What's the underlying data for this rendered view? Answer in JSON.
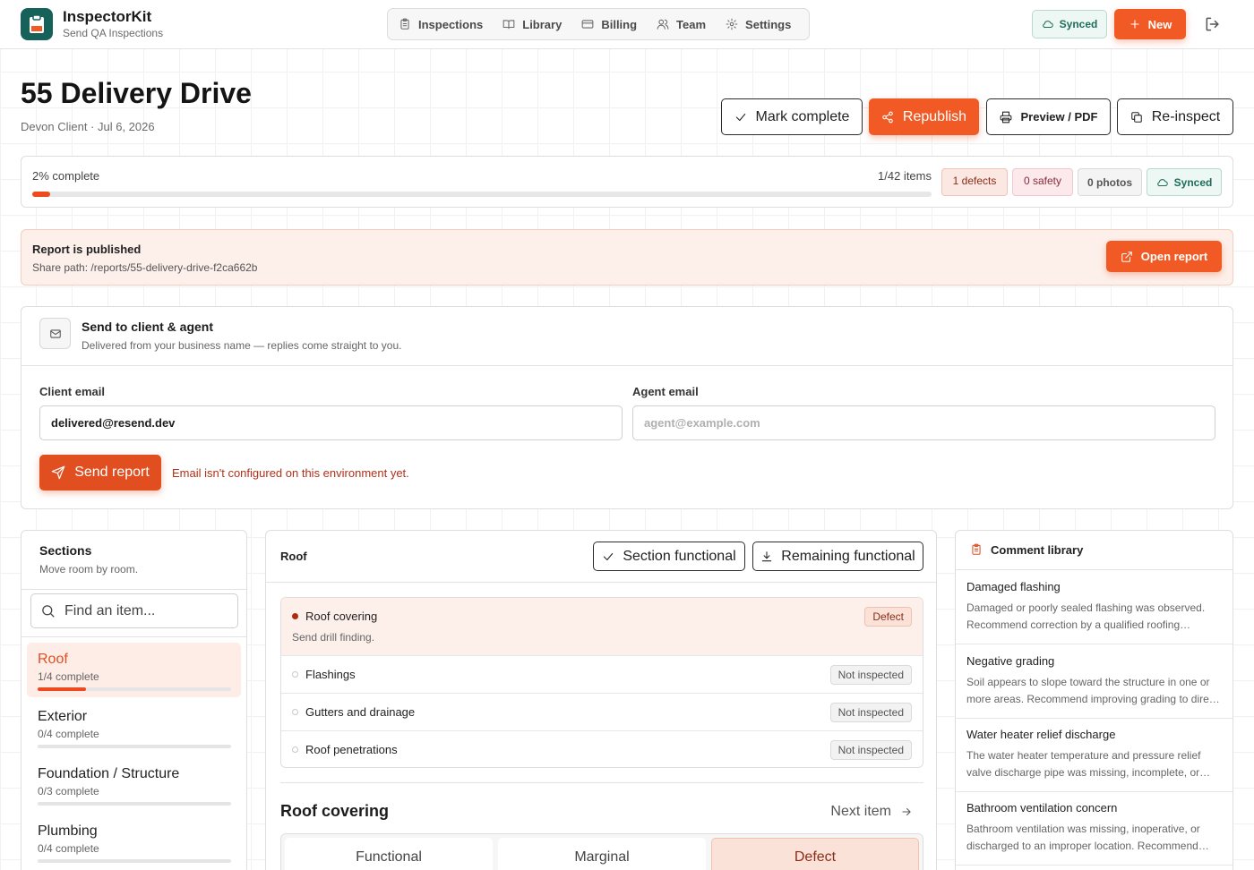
{
  "app": {
    "name": "InspectorKit",
    "tagline": "Send QA Inspections"
  },
  "nav": [
    {
      "label": "Inspections",
      "icon": "clipboard-icon"
    },
    {
      "label": "Library",
      "icon": "book-icon"
    },
    {
      "label": "Billing",
      "icon": "credit-card-icon"
    },
    {
      "label": "Team",
      "icon": "users-icon"
    },
    {
      "label": "Settings",
      "icon": "gear-icon"
    }
  ],
  "topbar": {
    "synced_label": "Synced",
    "new_label": "New"
  },
  "inspection": {
    "title": "55 Delivery Drive",
    "subtitle": "Devon Client · Jul 6, 2026"
  },
  "actions": {
    "mark_complete": "Mark complete",
    "republish": "Republish",
    "preview_pdf": "Preview / PDF",
    "reinspect": "Re-inspect"
  },
  "progress": {
    "label": "2% complete",
    "fraction": 0.02,
    "items": "1/42 items",
    "defects": "1 defects",
    "safety": "0 safety",
    "photos": "0 photos",
    "synced": "Synced"
  },
  "published": {
    "title": "Report is published",
    "path": "Share path: /reports/55-delivery-drive-f2ca662b",
    "open_label": "Open report"
  },
  "send": {
    "title": "Send to client & agent",
    "description": "Delivered from your business name — replies come straight to you.",
    "client_label": "Client email",
    "client_value": "delivered@resend.dev",
    "agent_label": "Agent email",
    "agent_placeholder": "agent@example.com",
    "send_label": "Send report",
    "error": "Email isn't configured on this environment yet."
  },
  "sections": {
    "title": "Sections",
    "subtitle": "Move room by room.",
    "search_placeholder": "Find an item...",
    "items": [
      {
        "name": "Roof",
        "count": "1/4 complete",
        "fraction": 0.25,
        "active": true
      },
      {
        "name": "Exterior",
        "count": "0/4 complete",
        "fraction": 0,
        "active": false
      },
      {
        "name": "Foundation / Structure",
        "count": "0/3 complete",
        "fraction": 0,
        "active": false
      },
      {
        "name": "Plumbing",
        "count": "0/4 complete",
        "fraction": 0,
        "active": false
      }
    ]
  },
  "middle": {
    "section_name": "Roof",
    "section_functional": "Section functional",
    "remaining_functional": "Remaining functional",
    "items": [
      {
        "name": "Roof covering",
        "status": "Defect",
        "note": "Send drill finding."
      },
      {
        "name": "Flashings",
        "status": "Not inspected"
      },
      {
        "name": "Gutters and drainage",
        "status": "Not inspected"
      },
      {
        "name": "Roof penetrations",
        "status": "Not inspected"
      }
    ],
    "detail_title": "Roof covering",
    "next_item": "Next item",
    "ratings": [
      "Functional",
      "Marginal",
      "Defect"
    ],
    "selected_rating": "Defect"
  },
  "library": {
    "title": "Comment library",
    "items": [
      {
        "name": "Damaged flashing",
        "text": "Damaged or poorly sealed flashing was observed. Recommend correction by a qualified roofing contractor."
      },
      {
        "name": "Negative grading",
        "text": "Soil appears to slope toward the structure in one or more areas. Recommend improving grading to direct water away."
      },
      {
        "name": "Water heater relief discharge",
        "text": "The water heater temperature and pressure relief valve discharge pipe was missing, incomplete, or improperly routed."
      },
      {
        "name": "Bathroom ventilation concern",
        "text": "Bathroom ventilation was missing, inoperative, or discharged to an improper location. Recommend correction."
      }
    ]
  },
  "colors": {
    "accent": "#f15a24",
    "brand": "#16615a",
    "defect_bg": "#fdf0eb",
    "synced": "#1f6c5a"
  }
}
